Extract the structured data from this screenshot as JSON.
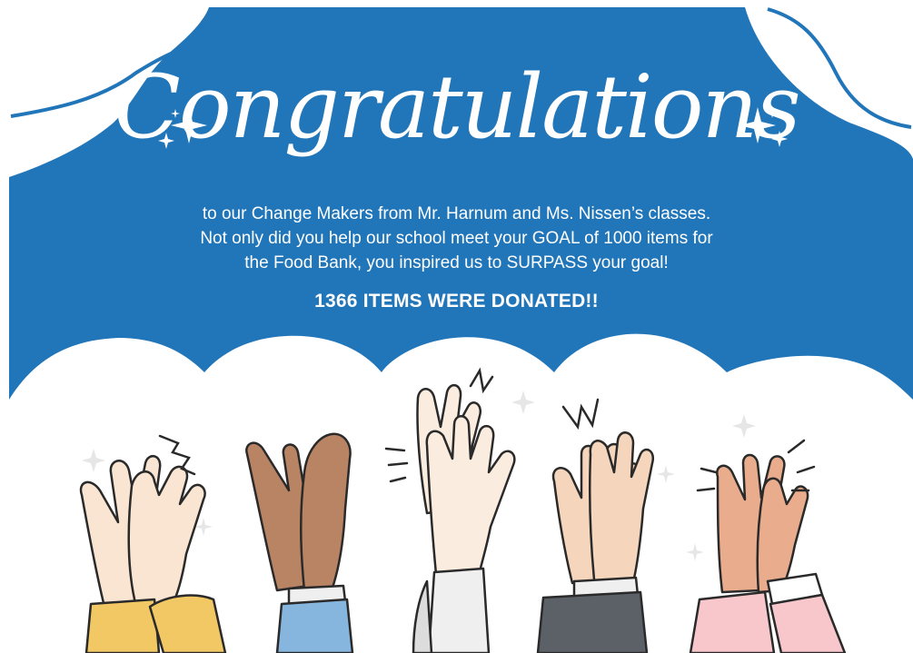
{
  "card": {
    "title": "Congratulations",
    "message_lines": [
      "to our Change Makers from Mr. Harnum and Ms. Nissen’s classes.",
      "Not only did you help our school meet your GOAL of 1000 items for",
      "the Food Bank, you  inspired us to SURPASS your goal!"
    ],
    "headline": "1366 ITEMS WERE DONATED!!"
  },
  "colors": {
    "banner_blue": "#2175b9",
    "white": "#ffffff",
    "outline": "#2a2a2a",
    "sleeve_yellow": "#f2c865",
    "sleeve_blue": "#86b5de",
    "sleeve_white": "#efefef",
    "sleeve_gray": "#5c6168",
    "sleeve_pink": "#f7c7cc",
    "skin_light": "#f9e5d2",
    "skin_brown": "#b98464",
    "skin_pale": "#fbece0",
    "skin_peach": "#f5d6bc",
    "skin_tan": "#e9ad8d"
  },
  "icons": [
    "sparkle-icon",
    "clapping-hands-illustration"
  ]
}
